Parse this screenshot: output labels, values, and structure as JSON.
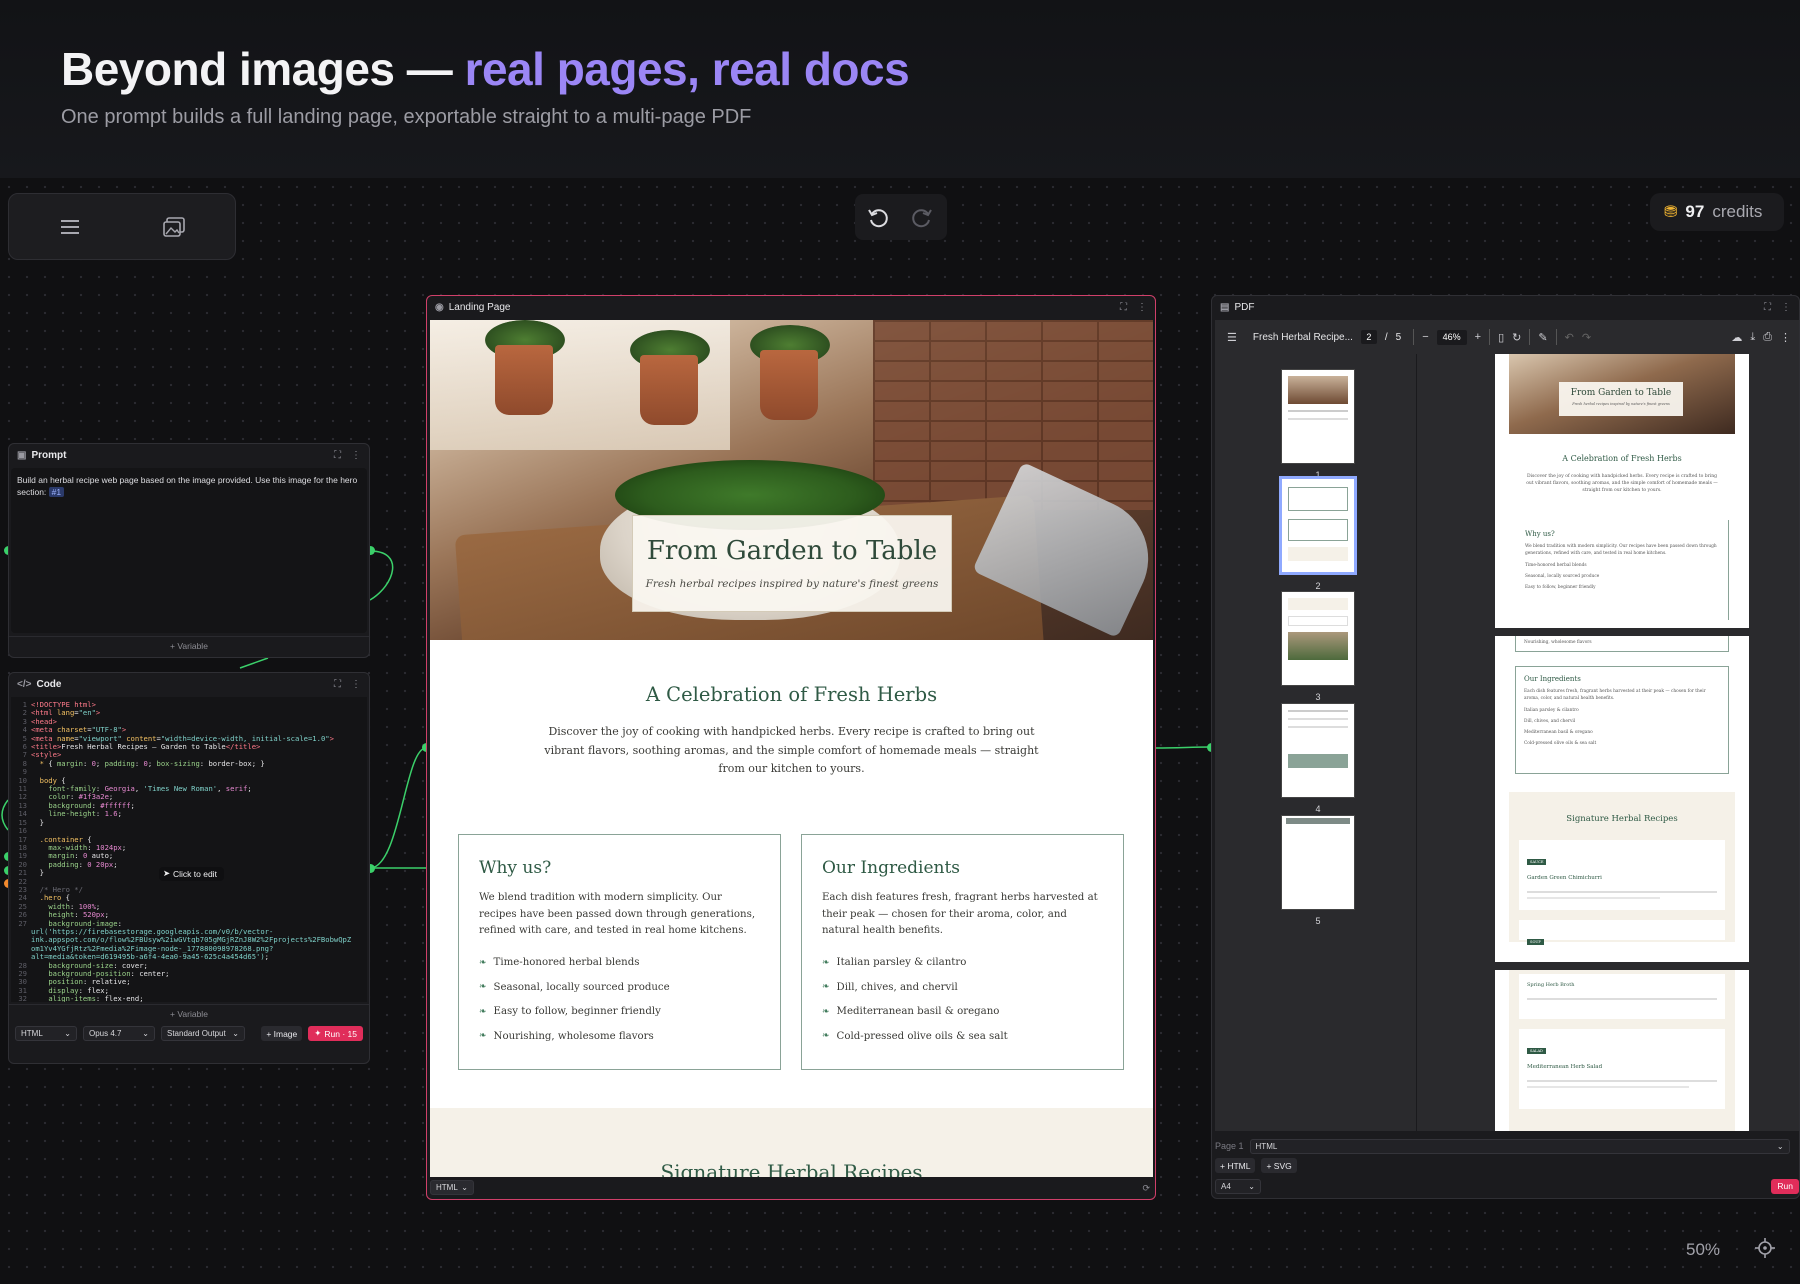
{
  "header": {
    "title_plain": "Beyond images — ",
    "title_accent": "real pages, real docs",
    "subtitle": "One prompt builds a full landing page, exportable straight to a multi-page PDF"
  },
  "toolbar": {
    "menu_icon": "hamburger-icon",
    "gallery_icon": "image-gallery-icon"
  },
  "history": {
    "undo_icon": "undo-icon",
    "redo_icon": "redo-icon"
  },
  "credits": {
    "amount": "97",
    "label": "credits",
    "icon": "coins-icon"
  },
  "prompt_node": {
    "title": "Prompt",
    "text": "Build an herbal recipe web page based on the image provided. Use this image for the hero section:",
    "tag": "#1",
    "variable_label": "+ Variable"
  },
  "code_node": {
    "title": "Code",
    "lines": [
      {
        "n": "1",
        "html": "<span class='c-tag'>&lt;!DOCTYPE html&gt;</span>"
      },
      {
        "n": "2",
        "html": "<span class='c-tag'>&lt;html</span> <span class='c-attr'>lang</span>=<span class='c-str'>\"en\"</span><span class='c-tag'>&gt;</span>"
      },
      {
        "n": "3",
        "html": "<span class='c-tag'>&lt;head&gt;</span>"
      },
      {
        "n": "4",
        "html": "<span class='c-tag'>&lt;meta</span> <span class='c-attr'>charset</span>=<span class='c-str'>\"UTF-8\"</span><span class='c-tag'>&gt;</span>"
      },
      {
        "n": "5",
        "html": "<span class='c-tag'>&lt;meta</span> <span class='c-attr'>name</span>=<span class='c-str'>\"viewport\"</span> <span class='c-attr'>content</span>=<span class='c-str'>\"width=device-width, initial-scale=1.0\"</span><span class='c-tag'>&gt;</span>"
      },
      {
        "n": "6",
        "html": "<span class='c-tag'>&lt;title&gt;</span><span class='c-txt'>Fresh Herbal Recipes — Garden to Table</span><span class='c-tag'>&lt;/title&gt;</span>"
      },
      {
        "n": "7",
        "html": "<span class='c-tag'>&lt;style&gt;</span>"
      },
      {
        "n": "8",
        "html": "  <span class='c-sel'>*</span> <span class='c-txt'>{</span> <span class='c-prop'>margin</span>: <span class='c-val'>0</span>; <span class='c-prop'>padding</span>: <span class='c-val'>0</span>; <span class='c-prop'>box-sizing</span>: <span class='c-txt'>border-box</span>; <span class='c-txt'>}</span>"
      },
      {
        "n": "9",
        "html": ""
      },
      {
        "n": "10",
        "html": "  <span class='c-sel'>body</span> <span class='c-txt'>{</span>"
      },
      {
        "n": "11",
        "html": "    <span class='c-prop'>font-family</span>: <span class='c-val'>Georgia</span>, <span class='c-str'>'Times New Roman'</span>, <span class='c-val'>serif</span>;"
      },
      {
        "n": "12",
        "html": "    <span class='c-prop'>color</span>: <span class='c-val'>#1f3a2e</span>;"
      },
      {
        "n": "13",
        "html": "    <span class='c-prop'>background</span>: <span class='c-val'>#ffffff</span>;"
      },
      {
        "n": "14",
        "html": "    <span class='c-prop'>line-height</span>: <span class='c-val'>1.6</span>;"
      },
      {
        "n": "15",
        "html": "  <span class='c-txt'>}</span>"
      },
      {
        "n": "16",
        "html": ""
      },
      {
        "n": "17",
        "html": "  <span class='c-sel'>.container</span> <span class='c-txt'>{</span>"
      },
      {
        "n": "18",
        "html": "    <span class='c-prop'>max-width</span>: <span class='c-val'>1024px</span>;"
      },
      {
        "n": "19",
        "html": "    <span class='c-prop'>margin</span>: <span class='c-val'>0</span> <span class='c-txt'>auto</span>;"
      },
      {
        "n": "20",
        "html": "    <span class='c-prop'>padding</span>: <span class='c-val'>0 20px</span>;"
      },
      {
        "n": "21",
        "html": "  <span class='c-txt'>}</span>"
      },
      {
        "n": "22",
        "html": ""
      },
      {
        "n": "23",
        "html": "  <span class='c-com'>/* Hero */</span>"
      },
      {
        "n": "24",
        "html": "  <span class='c-sel'>.hero</span> <span class='c-txt'>{</span>"
      },
      {
        "n": "25",
        "html": "    <span class='c-prop'>width</span>: <span class='c-val'>100%</span>;"
      },
      {
        "n": "26",
        "html": "    <span class='c-prop'>height</span>: <span class='c-val'>520px</span>;"
      },
      {
        "n": "27",
        "html": "    <span class='c-prop'>background-image</span>:"
      },
      {
        "n": "",
        "html": "<span class='c-str'>url('https://firebasestorage.googleapis.com/v0/b/vector-</span>"
      },
      {
        "n": "",
        "html": "<span class='c-str'>ink.appspot.com/o/flow%2FBUsyw%2iwGVtqb705gMGjRZnJ8W2%2Fprojects%2FBobwQpZ</span>"
      },
      {
        "n": "",
        "html": "<span class='c-str'>om1Yv4YGfjRtz%2Fmedia%2Fimage-node-_177880098978268.png?</span>"
      },
      {
        "n": "",
        "html": "<span class='c-str'>alt=media&amp;token=d619495b-a6f4-4ea0-9a45-625c4a454d65')</span>;"
      },
      {
        "n": "28",
        "html": "    <span class='c-prop'>background-size</span>: <span class='c-txt'>cover</span>;"
      },
      {
        "n": "29",
        "html": "    <span class='c-prop'>background-position</span>: <span class='c-txt'>center</span>;"
      },
      {
        "n": "30",
        "html": "    <span class='c-prop'>position</span>: <span class='c-txt'>relative</span>;"
      },
      {
        "n": "31",
        "html": "    <span class='c-prop'>display</span>: <span class='c-txt'>flex</span>;"
      },
      {
        "n": "32",
        "html": "    <span class='c-prop'>align-items</span>: <span class='c-txt'>flex-end</span>;"
      }
    ],
    "click_to_edit": "Click to edit",
    "variable_label": "+ Variable",
    "format_select": "HTML",
    "model_select": "Opus 4.7",
    "output_select": "Standard Output",
    "image_button": "+ Image",
    "run_button": "Run · 15"
  },
  "landing_node": {
    "title": "Landing Page",
    "hero_title": "From Garden to Table",
    "hero_subtitle": "Fresh herbal recipes inspired by nature's finest greens",
    "section_title": "A Celebration of Fresh Herbs",
    "section_text": "Discover the joy of cooking with handpicked herbs. Every recipe is crafted to bring out vibrant flavors, soothing aromas, and the simple comfort of homemade meals — straight from our kitchen to yours.",
    "cards": [
      {
        "title": "Why us?",
        "text": "We blend tradition with modern simplicity. Our recipes have been passed down through generations, refined with care, and tested in real home kitchens.",
        "items": [
          "Time-honored herbal blends",
          "Seasonal, locally sourced produce",
          "Easy to follow, beginner friendly",
          "Nourishing, wholesome flavors"
        ]
      },
      {
        "title": "Our Ingredients",
        "text": "Each dish features fresh, fragrant herbs harvested at their peak — chosen for their aroma, color, and natural health benefits.",
        "items": [
          "Italian parsley & cilantro",
          "Dill, chives, and chervil",
          "Mediterranean basil & oregano",
          "Cold-pressed olive oils & sea salt"
        ]
      }
    ],
    "next_section_title": "Signature Herbal Recipes",
    "footer_format": "HTML"
  },
  "pdf_node": {
    "title": "PDF",
    "doc_name": "Fresh Herbal Recipe...",
    "page_current": "2",
    "page_total": "5",
    "page_separator": "/",
    "zoom": "46%",
    "thumb_numbers": [
      "1",
      "2",
      "3",
      "4",
      "5"
    ],
    "preview": {
      "hero_title": "From Garden to Table",
      "hero_sub": "Fresh herbal recipes inspired by nature's finest greens",
      "section_title": "A Celebration of Fresh Herbs",
      "section_text": "Discover the joy of cooking with handpicked herbs. Every recipe is crafted to bring out vibrant flavors, soothing aromas, and the simple comfort of homemade meals — straight from our kitchen to yours.",
      "why_title": "Why us?",
      "why_text": "We blend tradition with modern simplicity. Our recipes have been passed down through generations, refined with care, and tested in real home kitchens.",
      "why_items": [
        "Time-honored herbal blends",
        "Seasonal, locally sourced produce",
        "Easy to follow, beginner friendly"
      ],
      "p2_item": "Nourishing, wholesome flavors",
      "ing_title": "Our Ingredients",
      "ing_text": "Each dish features fresh, fragrant herbs harvested at their peak — chosen for their aroma, color, and natural health benefits.",
      "ing_items": [
        "Italian parsley & cilantro",
        "Dill, chives, and chervil",
        "Mediterranean basil & oregano",
        "Cold-pressed olive oils & sea salt"
      ],
      "sig_title": "Signature Herbal Recipes",
      "badge1": "SAUCE",
      "recipe1": "Garden Green Chimichurri",
      "badge2": "SOUP",
      "recipe_spring": "Spring Herb Broth",
      "badge3": "SALAD",
      "recipe3": "Mediterranean Herb Salad"
    },
    "page_label": "Page 1",
    "format_select": "HTML",
    "add_html": "+ HTML",
    "add_svg": "+ SVG",
    "paper_select": "A4",
    "run_button": "Run"
  },
  "canvas": {
    "zoom": "50%",
    "recenter_icon": "crosshair-icon"
  },
  "colors": {
    "accent": "#9b86f5",
    "run": "#e02d5a",
    "connector": "#3bd06a",
    "landing_border": "#d0406a"
  }
}
